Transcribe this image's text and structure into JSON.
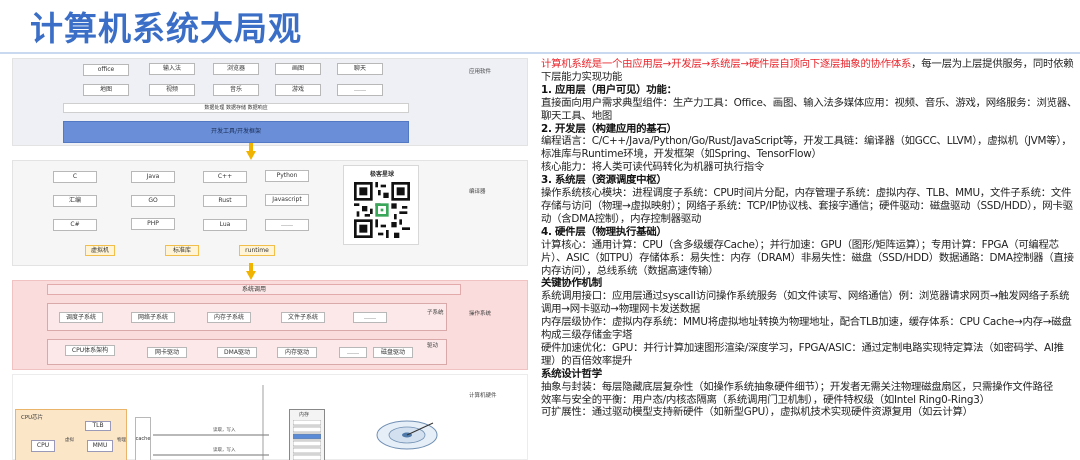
{
  "title": "计算机系统大局观",
  "diagram": {
    "app": {
      "row1": [
        "office",
        "输入法",
        "浏览器",
        "画图",
        "聊天"
      ],
      "row2": [
        "地图",
        "视频",
        "音乐",
        "游戏",
        "……"
      ],
      "data_flow": "数据处理  数据存储  数据响应",
      "toolbar": "开发工具/开发框架",
      "side_label": "应用软件"
    },
    "dev": {
      "langs": [
        "C",
        "Java",
        "C++",
        "Python",
        "汇编",
        "GO",
        "Rust",
        "Javascript",
        "C#",
        "PHP",
        "Lua",
        "……"
      ],
      "qr_caption": "极客星球",
      "side_label": "编译器",
      "runtime": [
        "虚拟机",
        "标准库",
        "runtime"
      ]
    },
    "os": {
      "syscall": "系统调用",
      "subsystems": [
        "调度子系统",
        "网络子系统",
        "内存子系统",
        "文件子系统",
        "……"
      ],
      "subsystem_label": "子系统",
      "drivers": [
        "CPU体系架构",
        "网卡驱动",
        "DMA驱动",
        "内存驱动",
        "……",
        "磁盘驱动"
      ],
      "driver_label": "驱动",
      "side_label": "操作系统"
    },
    "hw": {
      "side_label": "计算机硬件",
      "cpu_label": "CPU芯片",
      "tlb": "TLB",
      "cpu": "CPU",
      "mmu": "MMU",
      "cache": "cache",
      "addr1": "虚拟",
      "addr2": "物理",
      "bus1": "读取，写入",
      "bus2": "读取，写入",
      "mem_label": "内存"
    }
  },
  "text": {
    "intro_red": "计算机系统是一个由应用层→开发层→系统层→硬件层自顶向下逐层抽象的协作体系",
    "intro_rest": "，每一层为上层提供服务，同时依赖下层能力实现功能",
    "s1_head": "1. 应用层（用户可见）功能：",
    "s1_body": "直接面向用户需求典型组件：生产力工具：Office、画图、输入法多媒体应用：视频、音乐、游戏，网络服务：浏览器、聊天工具、地图",
    "s2_head": "2. 开发层（构建应用的基石）",
    "s2_body1": "编程语言：C/C++/Java/Python/Go/Rust/JavaScript等，开发工具链：编译器（如GCC、LLVM），虚拟机（JVM等），标准库与Runtime环境，开发框架（如Spring、TensorFlow）",
    "s2_body2": "核心能力：将人类可读代码转化为机器可执行指令",
    "s3_head": "3. 系统层（资源调度中枢）",
    "s3_body": "操作系统核心模块：进程调度子系统：CPU时间片分配，内存管理子系统：虚拟内存、TLB、MMU，文件子系统：文件存储与访问（物理→虚拟映射）；网络子系统：TCP/IP协议栈、套接字通信；硬件驱动：磁盘驱动（SSD/HDD），网卡驱动（含DMA控制），内存控制器驱动",
    "s4_head": "4. 硬件层（物理执行基础）",
    "s4_body": "计算核心：通用计算：CPU（含多级缓存Cache）；并行加速：GPU（图形/矩阵运算）；专用计算：FPGA（可编程芯片）、ASIC（如TPU）存储体系：易失性：内存（DRAM）非易失性：磁盘（SSD/HDD）数据通路：DMA控制器（直接内存访问），总线系统（数据高速传输）",
    "k_head": "关键协作机制",
    "k_body1": "系统调用接口：应用层通过syscall访问操作系统服务（如文件读写、网络通信）例：浏览器请求网页→触发网络子系统调用→网卡驱动→物理网卡发送数据",
    "k_body2": "内存层级协作：虚拟内存系统：MMU将虚拟地址转换为物理地址，配合TLB加速，缓存体系：CPU Cache→内存→磁盘构成三级存储金字塔",
    "k_body3": "硬件加速优化：GPU：并行计算加速图形渲染/深度学习，FPGA/ASIC：通过定制电路实现特定算法（如密码学、AI推理）的百倍效率提升",
    "d_head": "系统设计哲学",
    "d_body1": "抽象与封装：每层隐藏底层复杂性（如操作系统抽象硬件细节）；开发者无需关注物理磁盘扇区，只需操作文件路径",
    "d_body2": "效率与安全的平衡：用户态/内核态隔离（系统调用门卫机制），硬件特权级（如Intel Ring0-Ring3）",
    "d_body3": "可扩展性：通过驱动模型支持新硬件（如新型GPU），虚拟机技术实现硬件资源复用（如云计算）"
  }
}
